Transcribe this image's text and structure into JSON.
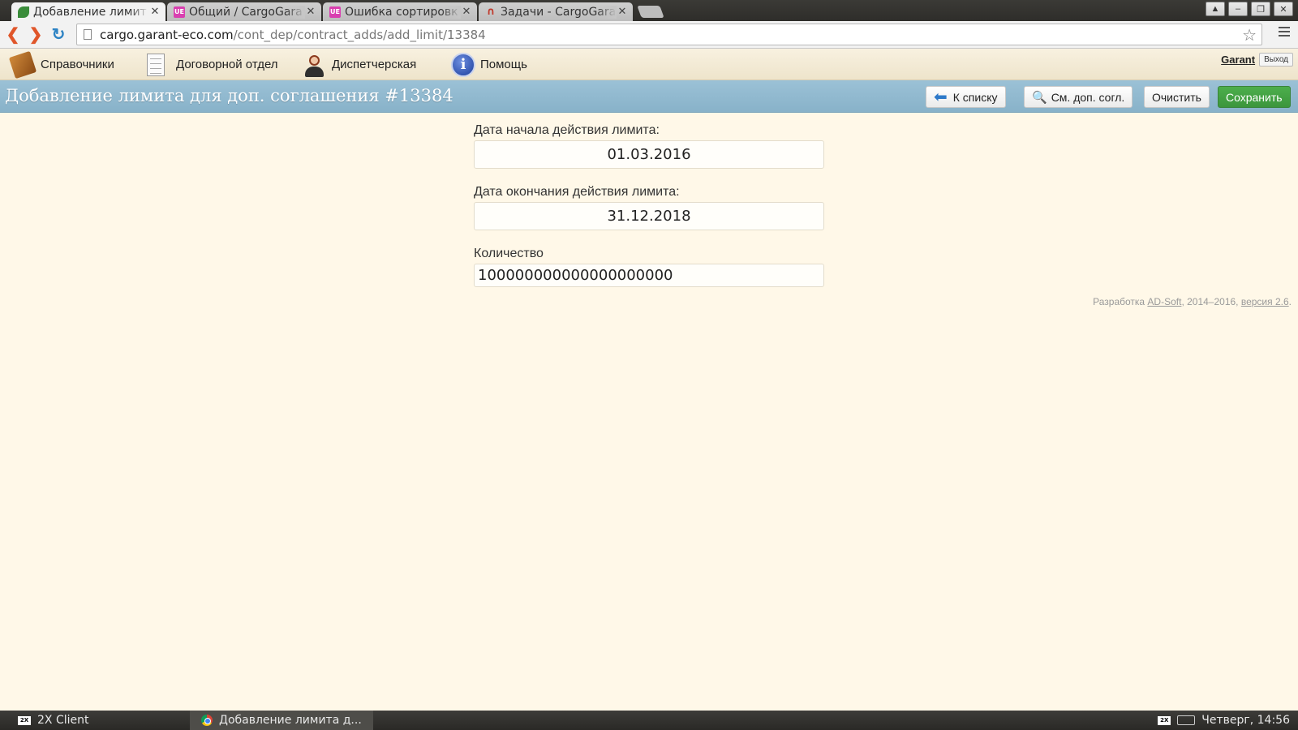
{
  "browser": {
    "tabs": [
      {
        "title": "Добавление лимит",
        "favicon": "leaf-icon",
        "active": true
      },
      {
        "title": "Общий / CargoGara",
        "favicon": "UE",
        "active": false
      },
      {
        "title": "Ошибка сортировк",
        "favicon": "UE",
        "active": false
      },
      {
        "title": "Задачи - CargoGara",
        "favicon": "headset-icon",
        "active": false
      }
    ],
    "url_host": "cargo.garant-eco.com",
    "url_path": "/cont_dep/contract_adds/add_limit/13384"
  },
  "appnav": {
    "items": [
      {
        "label": "Справочники",
        "icon": "book-icon"
      },
      {
        "label": "Договорной отдел",
        "icon": "document-icon"
      },
      {
        "label": "Диспетчерская",
        "icon": "dispatcher-icon"
      },
      {
        "label": "Помощь",
        "icon": "info-icon"
      }
    ],
    "username": "Garant",
    "logout": "Выход"
  },
  "titlebar": {
    "title": "Добавление лимита для доп. соглашения #13384",
    "back_label": "К списку",
    "view_label": "См. доп. согл.",
    "clear_label": "Очистить",
    "save_label": "Сохранить"
  },
  "form": {
    "start_label": "Дата начала действия лимита:",
    "start_value": "01.03.2016",
    "end_label": "Дата окончания действия лимита:",
    "end_value": "31.12.2018",
    "qty_label": "Количество",
    "qty_value": "100000000000000000000"
  },
  "footer": {
    "prefix": "Разработка ",
    "company": "AD-Soft",
    "years": ", 2014–2016, ",
    "version": "версия 2.6",
    "suffix": "."
  },
  "taskbar": {
    "items": [
      {
        "label": "2X Client"
      },
      {
        "label": "Добавление лимита д..."
      }
    ],
    "clock": "Четверг, 14:56"
  },
  "colors": {
    "page_bg": "#fff8e8",
    "titlebar_bg": "#93bad0",
    "save_bg": "#44a244"
  }
}
